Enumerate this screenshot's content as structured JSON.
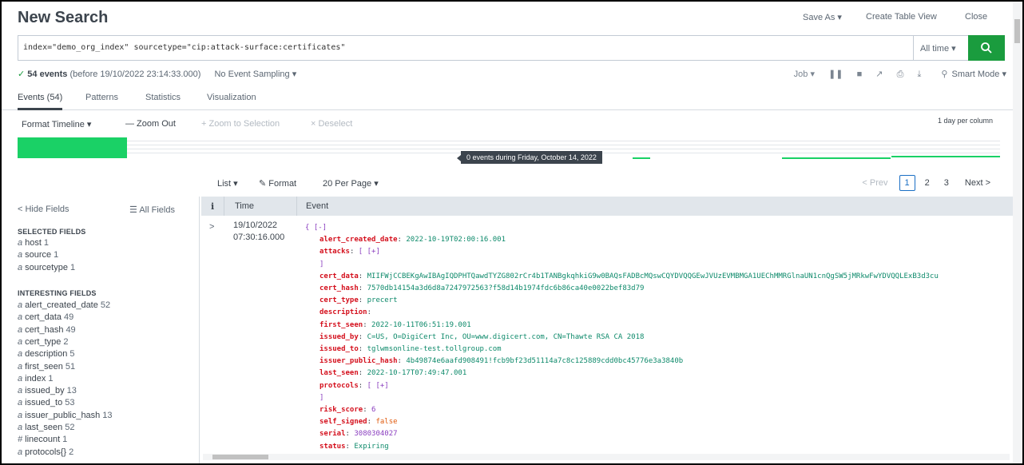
{
  "header": {
    "title": "New Search",
    "save_as": "Save As ▾",
    "create_table_view": "Create Table View",
    "close": "Close"
  },
  "search": {
    "query": "index=\"demo_org_index\" sourcetype=\"cip:attack-surface:certificates\"",
    "time_range": "All time ▾"
  },
  "status": {
    "count": "54 events",
    "before": "(before 19/10/2022 23:14:33.000)",
    "sampling": "No Event Sampling ▾",
    "job": "Job ▾",
    "mode": "Smart Mode ▾"
  },
  "tabs": [
    "Events (54)",
    "Patterns",
    "Statistics",
    "Visualization"
  ],
  "timeline": {
    "format": "Format Timeline ▾",
    "zoom_out": "— Zoom Out",
    "zoom_selection": "+ Zoom to Selection",
    "deselect": "× Deselect",
    "scale": "1 day per column",
    "tooltip": "0 events during Friday, October 14, 2022"
  },
  "list_controls": {
    "list": "List ▾",
    "format": "Format",
    "per_page": "20 Per Page ▾",
    "prev": "< Prev",
    "pages": [
      "1",
      "2",
      "3"
    ],
    "next": "Next >"
  },
  "sidebar": {
    "hide_fields": "< Hide Fields",
    "all_fields": "All Fields",
    "selected_title": "SELECTED FIELDS",
    "selected": [
      {
        "type": "a",
        "name": "host",
        "count": "1"
      },
      {
        "type": "a",
        "name": "source",
        "count": "1"
      },
      {
        "type": "a",
        "name": "sourcetype",
        "count": "1"
      }
    ],
    "interesting_title": "INTERESTING FIELDS",
    "interesting": [
      {
        "type": "a",
        "name": "alert_created_date",
        "count": "52"
      },
      {
        "type": "a",
        "name": "cert_data",
        "count": "49"
      },
      {
        "type": "a",
        "name": "cert_hash",
        "count": "49"
      },
      {
        "type": "a",
        "name": "cert_type",
        "count": "2"
      },
      {
        "type": "a",
        "name": "description",
        "count": "5"
      },
      {
        "type": "a",
        "name": "first_seen",
        "count": "51"
      },
      {
        "type": "a",
        "name": "index",
        "count": "1"
      },
      {
        "type": "a",
        "name": "issued_by",
        "count": "13"
      },
      {
        "type": "a",
        "name": "issued_to",
        "count": "53"
      },
      {
        "type": "a",
        "name": "issuer_public_hash",
        "count": "13"
      },
      {
        "type": "a",
        "name": "last_seen",
        "count": "52"
      },
      {
        "type": "#",
        "name": "linecount",
        "count": "1"
      },
      {
        "type": "a",
        "name": "protocols{}",
        "count": "2"
      }
    ]
  },
  "table": {
    "col_i": "i",
    "col_time": "Time",
    "col_event": "Event"
  },
  "event": {
    "expander": ">",
    "date": "19/10/2022",
    "time": "07:30:16.000",
    "open": "{ [-]",
    "alert_created_date": {
      "k": "alert_created_date",
      "v": "2022-10-19T02:00:16.001"
    },
    "attacks": {
      "k": "attacks",
      "v": "[ [+]"
    },
    "attacks_close": "]",
    "cert_data": {
      "k": "cert_data",
      "v": "MIIFWjCCBEKgAwIBAgIQDPHTQawdTYZG802rCr4b1TANBgkqhkiG9w0BAQsFADBcMQswCQYDVQQGEwJVUzEVMBMGA1UEChMMRGlnaUN1cnQgSW5jMRkwFwYDVQQLExB3d3cu"
    },
    "cert_hash": {
      "k": "cert_hash",
      "v": "7570db14154a3d6d8a7247972563?f58d14b1974fdc6b86ca40e0022bef83d79"
    },
    "cert_type": {
      "k": "cert_type",
      "v": "precert"
    },
    "description": {
      "k": "description",
      "v": ""
    },
    "first_seen": {
      "k": "first_seen",
      "v": "2022-10-11T06:51:19.001"
    },
    "issued_by": {
      "k": "issued_by",
      "v": "C=US, O=DigiCert Inc, OU=www.digicert.com, CN=Thawte RSA CA 2018"
    },
    "issued_to": {
      "k": "issued_to",
      "v": "tglwmsonline-test.tollgroup.com"
    },
    "issuer_public_hash": {
      "k": "issuer_public_hash",
      "v": "4b49874e6aafd908491!fcb9bf23d51114a7c8c125889cdd0bc45776e3a3840b"
    },
    "last_seen": {
      "k": "last_seen",
      "v": "2022-10-17T07:49:47.001"
    },
    "protocols": {
      "k": "protocols",
      "v": "[ [+]"
    },
    "protocols_close": "]",
    "risk_score": {
      "k": "risk_score",
      "v": "6"
    },
    "self_signed": {
      "k": "self_signed",
      "v": "false"
    },
    "serial": {
      "k": "serial",
      "v": "3080304027"
    },
    "status": {
      "k": "status",
      "v": "Expiring"
    }
  },
  "colors": {
    "accent_green": "#1a9c3e",
    "timeline_green": "#1ad166",
    "key_red": "#d4101d",
    "value_teal": "#0e8a6b",
    "number_purple": "#8a3ebf"
  }
}
